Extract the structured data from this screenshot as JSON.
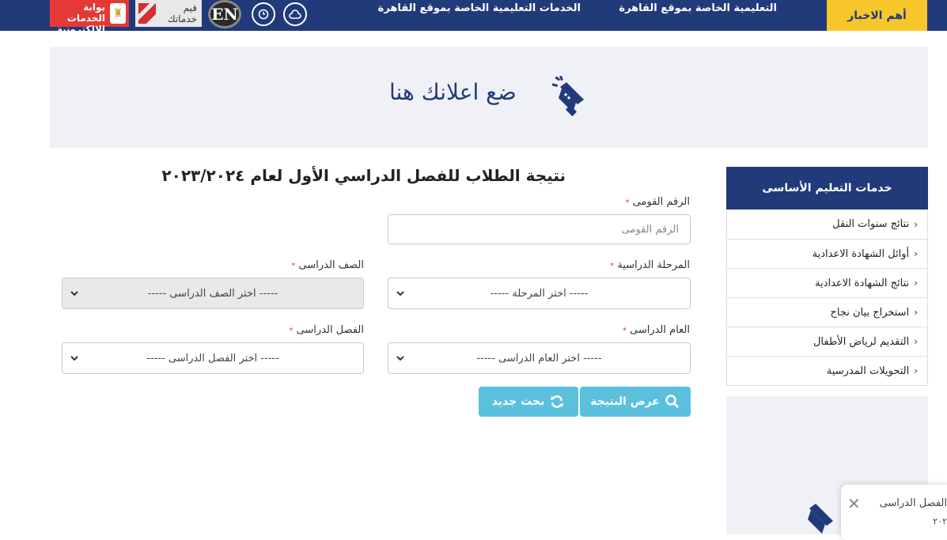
{
  "topbar": {
    "news_button": "أهم الاخبار",
    "nav_links": [
      "التعليمية الخاصة بموقع القاهرة",
      "الخدمات التعليمية الخاصة بموقع القاهرة"
    ],
    "en_logo": "EN",
    "qeem_logo": "قيم خدماتك",
    "portal_logo": "بوابة الخدمات الإلكترونية"
  },
  "ad_banner": {
    "text": "ضع اعلانك هنا",
    "icon": "megaphone-icon"
  },
  "form": {
    "title": "نتيجة الطلاب للفصل الدراسي الأول لعام ٢٠٢٣/٢٠٢٤",
    "required_mark": "*",
    "national_id": {
      "label": "الرقم القومى",
      "placeholder": "الرقم القومى"
    },
    "stage": {
      "label": "المرحلة الدراسية",
      "value": "----- اختر المرحلة -----"
    },
    "grade": {
      "label": "الصف الدراسى",
      "value": "----- اختر الصف الدراسى -----"
    },
    "year": {
      "label": "العام الدراسى",
      "value": "----- اختر العام الدراسى -----"
    },
    "term": {
      "label": "الفصل الدراسى",
      "value": "----- اختر الفصل الدراسى -----"
    },
    "show_button": "عرض النتيجة",
    "new_search_button": "بحث جديد"
  },
  "sidebar": {
    "title": "خدمات التعليم الأساسى",
    "items": [
      "نتائج سنوات النقل",
      "أوائل الشهادة الاعدادية",
      "نتائج الشهادة الاعدادية",
      "استخراج بيان نجاح",
      "التقديم لرياض الأطفال",
      "التحويلات المدرسية"
    ]
  },
  "popup": {
    "text": "الفصل الدراسى",
    "subtext": "٢٠٢"
  },
  "colors": {
    "primary": "#213a7a",
    "accent": "#f7c62b",
    "button": "#5bc0de",
    "required": "#e53935"
  }
}
